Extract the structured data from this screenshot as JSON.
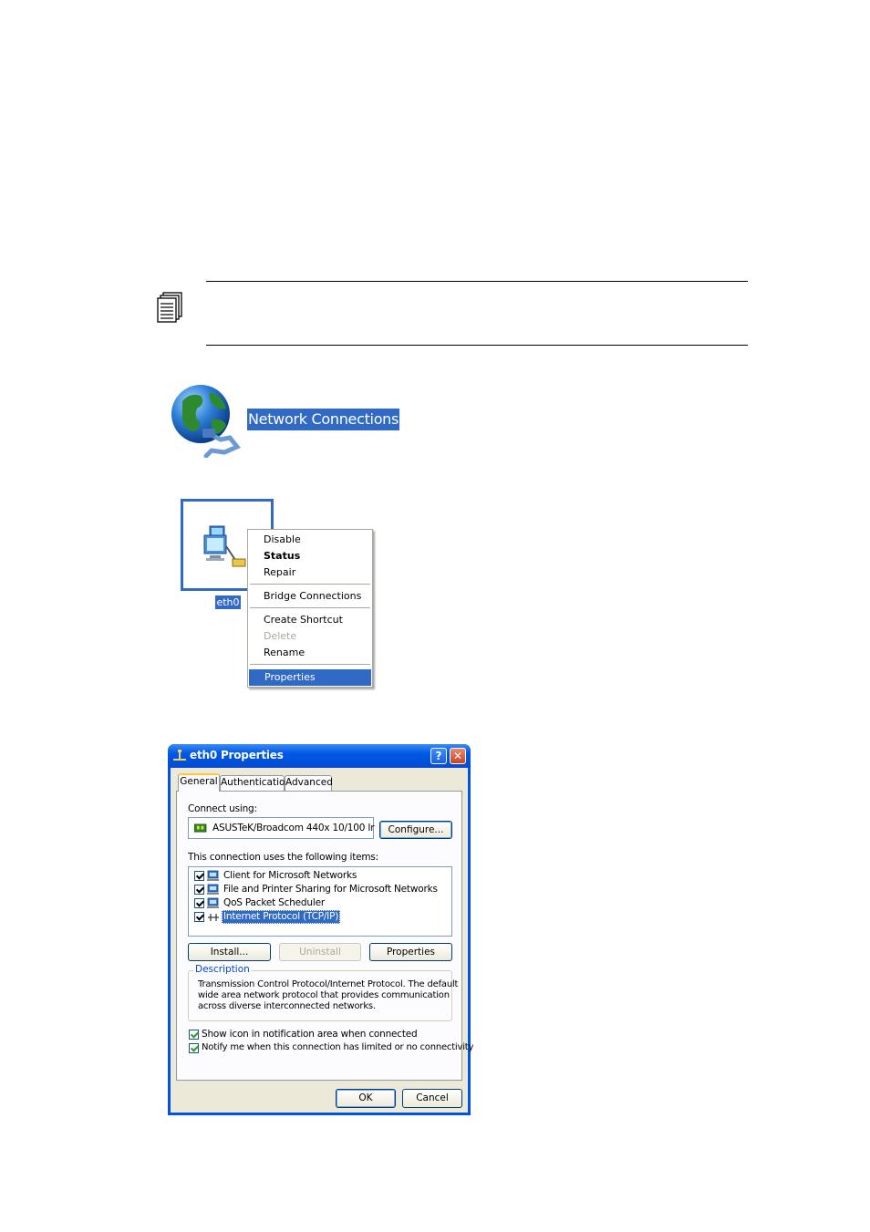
{
  "network_connections": {
    "label": "Network Connections",
    "icon": "globe-network-icon"
  },
  "connection": {
    "name": "eth0",
    "icon": "network-connection-icon"
  },
  "context_menu": {
    "items": [
      {
        "label": "Disable"
      },
      {
        "label": "Status"
      },
      {
        "label": "Repair"
      },
      {
        "label": "Bridge Connections"
      },
      {
        "label": "Create Shortcut"
      },
      {
        "label": "Delete"
      },
      {
        "label": "Rename"
      },
      {
        "label": "Properties"
      }
    ],
    "selected": "Properties",
    "highlight_color": "#316ac5"
  },
  "dialog": {
    "title": "eth0 Properties",
    "help_label": "?",
    "close_label": "✕",
    "tabs": [
      {
        "label": "General",
        "active": true
      },
      {
        "label": "Authentication",
        "active": false
      },
      {
        "label": "Advanced",
        "active": false
      }
    ],
    "connect_using_label": "Connect using:",
    "adapter_name": "ASUSTeK/Broadcom 440x 10/100 Ir",
    "configure_label": "Configure...",
    "items_label": "This connection uses the following items:",
    "items": [
      {
        "label": "Client for Microsoft Networks",
        "checked": true,
        "icon": "client-network-icon"
      },
      {
        "label": "File and Printer Sharing for Microsoft Networks",
        "checked": true,
        "icon": "file-printer-sharing-icon"
      },
      {
        "label": "QoS Packet Scheduler",
        "checked": true,
        "icon": "qos-scheduler-icon"
      },
      {
        "label": "Internet Protocol (TCP/IP)",
        "checked": true,
        "icon": "protocol-icon",
        "selected": true
      }
    ],
    "install_label": "Install...",
    "uninstall_label": "Uninstall",
    "properties_label": "Properties",
    "description_title": "Description",
    "description_lines": [
      "Transmission Control Protocol/Internet Protocol. The default",
      "wide area network protocol that provides communication",
      "across diverse interconnected networks."
    ],
    "show_icon_label": "Show icon in notification area when connected",
    "notify_label": "Notify me when this connection has limited or no connectivity",
    "ok_label": "OK",
    "cancel_label": "Cancel",
    "titlebar_color": "#0054e3"
  }
}
